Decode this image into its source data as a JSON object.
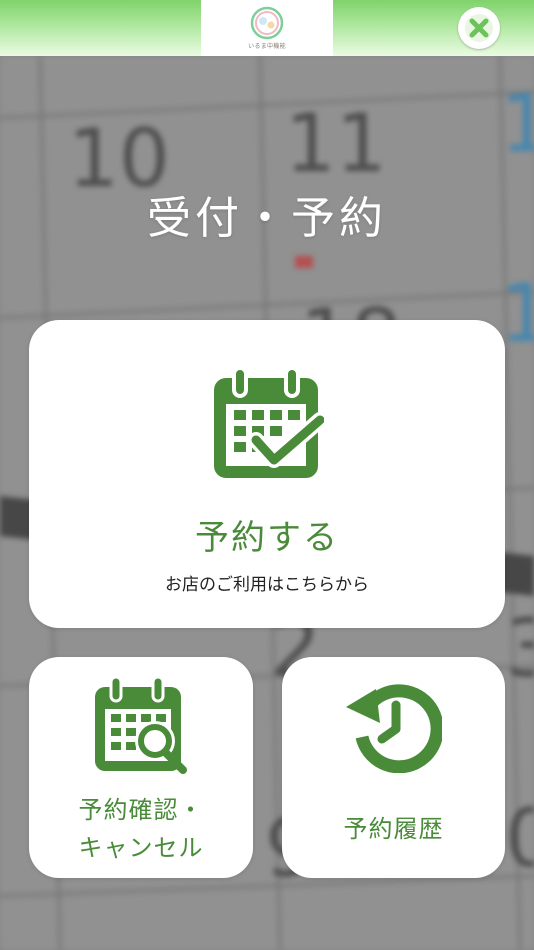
{
  "header": {
    "logo_text": "いるま中機能",
    "close_icon": "close-icon"
  },
  "page": {
    "title": "受付・予約"
  },
  "reserve_card": {
    "icon": "calendar-check-icon",
    "label": "予約する",
    "sublabel": "お店のご利用はこちらから"
  },
  "confirm_card": {
    "icon": "calendar-search-icon",
    "label_line1": "予約確認・",
    "label_line2": "キャンセル"
  },
  "history_card": {
    "icon": "history-clock-icon",
    "label": "予約履歴"
  },
  "colors": {
    "accent_green": "#4a8b3a",
    "header_green": "#7fd36a"
  }
}
